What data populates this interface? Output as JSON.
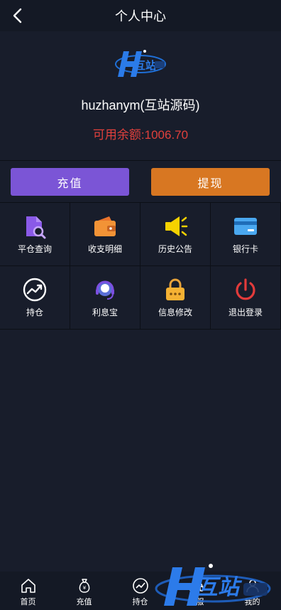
{
  "header": {
    "title": "个人中心",
    "back_icon": "chevron-left-icon"
  },
  "profile": {
    "logo_text": "互站",
    "username": "huzhanym(互站源码)",
    "balance_label": "可用余额:",
    "balance_value": "1006.70"
  },
  "actions": {
    "recharge_label": "充值",
    "withdraw_label": "提现"
  },
  "menu": [
    {
      "label": "平仓查询",
      "icon": "document-search-icon"
    },
    {
      "label": "收支明细",
      "icon": "wallet-icon"
    },
    {
      "label": "历史公告",
      "icon": "megaphone-icon"
    },
    {
      "label": "银行卡",
      "icon": "bank-card-icon"
    },
    {
      "label": "持仓",
      "icon": "trend-chart-icon"
    },
    {
      "label": "利息宝",
      "icon": "headset-icon"
    },
    {
      "label": "信息修改",
      "icon": "lock-icon"
    },
    {
      "label": "退出登录",
      "icon": "power-icon"
    }
  ],
  "tabbar": [
    {
      "label": "首页",
      "icon": "home-icon"
    },
    {
      "label": "充值",
      "icon": "money-bag-icon"
    },
    {
      "label": "持仓",
      "icon": "trend-chart-icon"
    },
    {
      "label": "客服",
      "icon": "headset-icon"
    },
    {
      "label": "我的",
      "icon": "user-icon"
    }
  ],
  "watermark": {
    "text": "互站"
  },
  "colors": {
    "background": "#181d2b",
    "recharge_button": "#7b55d6",
    "withdraw_button": "#d87722",
    "balance_text": "#e0403c"
  }
}
